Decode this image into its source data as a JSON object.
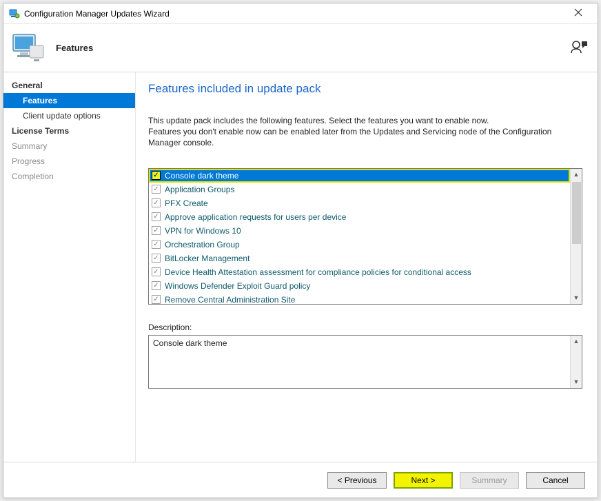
{
  "window": {
    "title": "Configuration Manager Updates Wizard"
  },
  "banner": {
    "title": "Features"
  },
  "nav": {
    "items": [
      {
        "label": "General",
        "kind": "section"
      },
      {
        "label": "Features",
        "kind": "sub",
        "active": true
      },
      {
        "label": "Client update options",
        "kind": "sub"
      },
      {
        "label": "License Terms",
        "kind": "section"
      },
      {
        "label": "Summary",
        "kind": "dim"
      },
      {
        "label": "Progress",
        "kind": "dim"
      },
      {
        "label": "Completion",
        "kind": "dim"
      }
    ]
  },
  "main": {
    "heading": "Features included in update pack",
    "intro": "This update pack includes the following features. Select the features you want to enable now.\nFeatures you don't enable now can be enabled later from the Updates and Servicing node of the Configuration Manager console.",
    "features": [
      {
        "label": "Console dark theme",
        "checked": true,
        "selected": true,
        "highlight": true
      },
      {
        "label": "Application Groups",
        "checked": true
      },
      {
        "label": "PFX Create",
        "checked": true
      },
      {
        "label": "Approve application requests for users per device",
        "checked": true
      },
      {
        "label": "VPN for Windows 10",
        "checked": true
      },
      {
        "label": "Orchestration Group",
        "checked": true
      },
      {
        "label": "BitLocker Management",
        "checked": true
      },
      {
        "label": "Device Health Attestation assessment for compliance policies for conditional access",
        "checked": true
      },
      {
        "label": "Windows Defender Exploit Guard policy",
        "checked": true
      },
      {
        "label": "Remove Central Administration Site",
        "checked": true
      }
    ],
    "description_label": "Description:",
    "description_value": "Console dark theme"
  },
  "footer": {
    "previous": "< Previous",
    "next": "Next >",
    "summary": "Summary",
    "cancel": "Cancel"
  },
  "icons": {
    "app": "cm-wizard-icon",
    "monitor": "monitor-icon",
    "feedback": "feedback-icon",
    "close": "close-icon",
    "scroll_up": "scroll-up-icon",
    "scroll_down": "scroll-down-icon"
  }
}
